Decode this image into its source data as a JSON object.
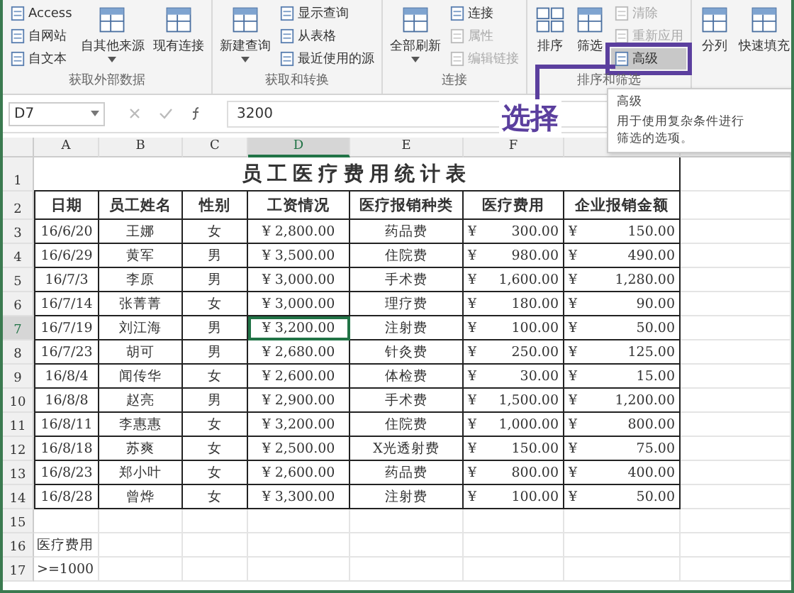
{
  "ribbon": {
    "groups": [
      {
        "label": "获取外部数据",
        "items": [
          {
            "kind": "stack",
            "entries": [
              {
                "label": "Access",
                "disabled": false
              },
              {
                "label": "自网站",
                "disabled": false
              },
              {
                "label": "自文本",
                "disabled": false
              }
            ]
          },
          {
            "kind": "large",
            "label": "自其他来源",
            "dropdown": true
          },
          {
            "kind": "large",
            "label": "现有连接",
            "dropdown": false
          }
        ]
      },
      {
        "label": "获取和转换",
        "items": [
          {
            "kind": "large",
            "label": "新建查询",
            "dropdown": true
          },
          {
            "kind": "stack",
            "entries": [
              {
                "label": "显示查询",
                "disabled": false
              },
              {
                "label": "从表格",
                "disabled": false
              },
              {
                "label": "最近使用的源",
                "disabled": false
              }
            ]
          }
        ]
      },
      {
        "label": "连接",
        "items": [
          {
            "kind": "large",
            "label": "全部刷新",
            "dropdown": true
          },
          {
            "kind": "stack",
            "entries": [
              {
                "label": "连接",
                "disabled": false
              },
              {
                "label": "属性",
                "disabled": true
              },
              {
                "label": "编辑链接",
                "disabled": true
              }
            ]
          }
        ]
      },
      {
        "label": "排序和筛选",
        "items": [
          {
            "kind": "sort",
            "label": "排序"
          },
          {
            "kind": "large",
            "label": "筛选",
            "dropdown": false
          },
          {
            "kind": "stack",
            "entries": [
              {
                "label": "清除",
                "disabled": true
              },
              {
                "label": "重新应用",
                "disabled": true
              },
              {
                "label": "高级",
                "disabled": false,
                "highlighted": true
              }
            ]
          }
        ]
      },
      {
        "items": [
          {
            "kind": "large",
            "label": "分列",
            "dropdown": false
          },
          {
            "kind": "large",
            "label": "快速填充",
            "dropdown": false
          }
        ]
      }
    ]
  },
  "annotation": {
    "text": "选择"
  },
  "tooltip": {
    "title": "高级",
    "body": "用于使用复杂条件进行筛选的选项。"
  },
  "formula_bar": {
    "name_box": "D7",
    "formula": "3200"
  },
  "sheet": {
    "columns": [
      {
        "label": "A",
        "selected": false
      },
      {
        "label": "B",
        "selected": false
      },
      {
        "label": "C",
        "selected": false
      },
      {
        "label": "D",
        "selected": true
      },
      {
        "label": "E",
        "selected": false
      },
      {
        "label": "F",
        "selected": false
      }
    ],
    "row_numbers": [
      "1",
      "2",
      "3",
      "4",
      "5",
      "6",
      "7",
      "8",
      "9",
      "10",
      "11",
      "12",
      "13",
      "14",
      "15",
      "16",
      "17"
    ],
    "title": "员工医疗费用统计表",
    "headers": [
      "日期",
      "员工姓名",
      "性别",
      "工资情况",
      "医疗报销种类",
      "医疗费用",
      "企业报销金额"
    ],
    "rows": [
      {
        "date": "16/6/20",
        "name": "王娜",
        "gender": "女",
        "salary": "¥ 2,800.00",
        "type": "药品费",
        "cost_symbol": "¥",
        "cost": "300.00",
        "reimb_symbol": "¥",
        "reimb": "150.00",
        "selected": false
      },
      {
        "date": "16/6/29",
        "name": "黄军",
        "gender": "男",
        "salary": "¥ 3,500.00",
        "type": "住院费",
        "cost_symbol": "¥",
        "cost": "980.00",
        "reimb_symbol": "¥",
        "reimb": "490.00",
        "selected": false
      },
      {
        "date": "16/7/3",
        "name": "李原",
        "gender": "男",
        "salary": "¥ 3,000.00",
        "type": "手术费",
        "cost_symbol": "¥",
        "cost": "1,600.00",
        "reimb_symbol": "¥",
        "reimb": "1,280.00",
        "selected": false
      },
      {
        "date": "16/7/14",
        "name": "张菁菁",
        "gender": "女",
        "salary": "¥ 3,000.00",
        "type": "理疗费",
        "cost_symbol": "¥",
        "cost": "180.00",
        "reimb_symbol": "¥",
        "reimb": "90.00",
        "selected": false
      },
      {
        "date": "16/7/19",
        "name": "刘江海",
        "gender": "男",
        "salary": "¥ 3,200.00",
        "type": "注射费",
        "cost_symbol": "¥",
        "cost": "100.00",
        "reimb_symbol": "¥",
        "reimb": "50.00",
        "selected": true
      },
      {
        "date": "16/7/23",
        "name": "胡可",
        "gender": "男",
        "salary": "¥ 2,680.00",
        "type": "针灸费",
        "cost_symbol": "¥",
        "cost": "250.00",
        "reimb_symbol": "¥",
        "reimb": "125.00",
        "selected": false
      },
      {
        "date": "16/8/4",
        "name": "闻传华",
        "gender": "女",
        "salary": "¥ 2,600.00",
        "type": "体检费",
        "cost_symbol": "¥",
        "cost": "30.00",
        "reimb_symbol": "¥",
        "reimb": "15.00",
        "selected": false
      },
      {
        "date": "16/8/8",
        "name": "赵亮",
        "gender": "男",
        "salary": "¥ 2,900.00",
        "type": "手术费",
        "cost_symbol": "¥",
        "cost": "1,500.00",
        "reimb_symbol": "¥",
        "reimb": "1,200.00",
        "selected": false
      },
      {
        "date": "16/8/11",
        "name": "李惠惠",
        "gender": "女",
        "salary": "¥ 3,200.00",
        "type": "住院费",
        "cost_symbol": "¥",
        "cost": "1,000.00",
        "reimb_symbol": "¥",
        "reimb": "800.00",
        "selected": false
      },
      {
        "date": "16/8/18",
        "name": "苏爽",
        "gender": "女",
        "salary": "¥ 2,500.00",
        "type": "X光透射费",
        "cost_symbol": "¥",
        "cost": "150.00",
        "reimb_symbol": "¥",
        "reimb": "75.00",
        "selected": false
      },
      {
        "date": "16/8/23",
        "name": "郑小叶",
        "gender": "女",
        "salary": "¥ 2,600.00",
        "type": "药品费",
        "cost_symbol": "¥",
        "cost": "800.00",
        "reimb_symbol": "¥",
        "reimb": "400.00",
        "selected": false
      },
      {
        "date": "16/8/28",
        "name": "曾烨",
        "gender": "女",
        "salary": "¥ 3,300.00",
        "type": "注射费",
        "cost_symbol": "¥",
        "cost": "100.00",
        "reimb_symbol": "¥",
        "reimb": "50.00",
        "selected": false
      }
    ],
    "criteria": [
      "医疗费用",
      ">=1000"
    ]
  }
}
